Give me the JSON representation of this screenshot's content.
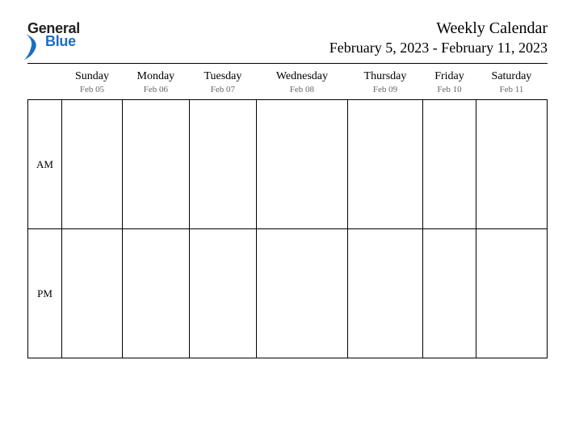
{
  "logo": {
    "line1": "General",
    "line2": "Blue",
    "swoosh_color": "#1b6ec2"
  },
  "header": {
    "title": "Weekly Calendar",
    "date_range": "February 5, 2023 - February 11, 2023"
  },
  "days": [
    {
      "name": "Sunday",
      "date": "Feb 05"
    },
    {
      "name": "Monday",
      "date": "Feb 06"
    },
    {
      "name": "Tuesday",
      "date": "Feb 07"
    },
    {
      "name": "Wednesday",
      "date": "Feb 08"
    },
    {
      "name": "Thursday",
      "date": "Feb 09"
    },
    {
      "name": "Friday",
      "date": "Feb 10"
    },
    {
      "name": "Saturday",
      "date": "Feb 11"
    }
  ],
  "periods": [
    {
      "label": "AM"
    },
    {
      "label": "PM"
    }
  ]
}
